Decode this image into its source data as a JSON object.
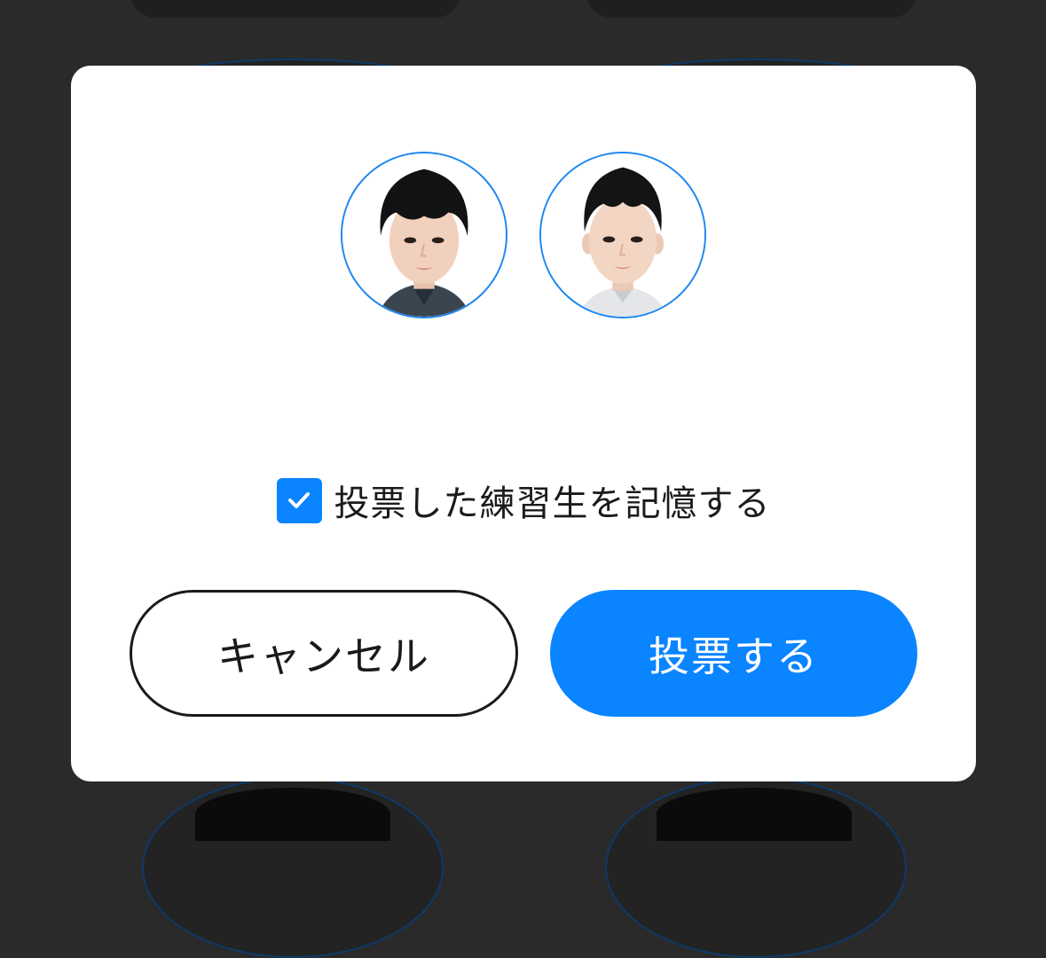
{
  "modal": {
    "avatars": [
      {
        "name": "trainee-1"
      },
      {
        "name": "trainee-2"
      }
    ],
    "remember_checked": true,
    "remember_label": "投票した練習生を記憶する",
    "cancel_label": "キャンセル",
    "vote_label": "投票する"
  },
  "colors": {
    "accent": "#0a84ff",
    "overlay": "#2a2a2a",
    "avatar_ring": "#1a86f0"
  }
}
